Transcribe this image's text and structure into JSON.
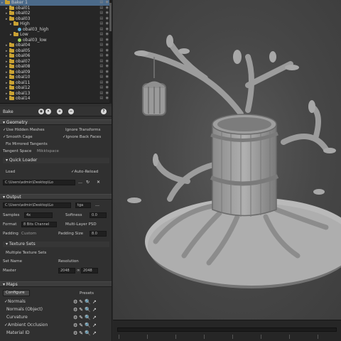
{
  "tree": {
    "rows": [
      {
        "label": "Baker 1",
        "depth": 0,
        "type": "folder",
        "selected": true
      },
      {
        "label": "obal01",
        "depth": 1,
        "type": "folder"
      },
      {
        "label": "obal02",
        "depth": 1,
        "type": "folder"
      },
      {
        "label": "obal03",
        "depth": 1,
        "type": "folder"
      },
      {
        "label": "High",
        "depth": 2,
        "type": "folder"
      },
      {
        "label": "obal03_high",
        "depth": 3,
        "type": "mesh"
      },
      {
        "label": "Low",
        "depth": 2,
        "type": "folder"
      },
      {
        "label": "obal03_low",
        "depth": 3,
        "type": "meshg"
      },
      {
        "label": "obal04",
        "depth": 1,
        "type": "folder"
      },
      {
        "label": "obal05",
        "depth": 1,
        "type": "folder"
      },
      {
        "label": "obal06",
        "depth": 1,
        "type": "folder"
      },
      {
        "label": "obal07",
        "depth": 1,
        "type": "folder"
      },
      {
        "label": "obal08",
        "depth": 1,
        "type": "folder"
      },
      {
        "label": "obal09",
        "depth": 1,
        "type": "folder"
      },
      {
        "label": "obal10",
        "depth": 1,
        "type": "folder"
      },
      {
        "label": "obal11",
        "depth": 1,
        "type": "folder"
      },
      {
        "label": "obal12",
        "depth": 1,
        "type": "folder"
      },
      {
        "label": "obal13",
        "depth": 1,
        "type": "folder"
      },
      {
        "label": "obal14",
        "depth": 1,
        "type": "folder"
      }
    ]
  },
  "bake_bar": {
    "label": "Bake"
  },
  "geometry": {
    "title": "Geometry",
    "use_hidden_meshes": "Use Hidden Meshes",
    "ignore_transforms": "Ignore Transforms",
    "smooth_cage": "Smooth Cage",
    "ignore_back_faces": "Ignore Back Faces",
    "fix_mirrored_tangents": "Fix Mirrored Tangents",
    "tangent_space_label": "Tangent Space",
    "tangent_space_value": "Mikktspace"
  },
  "quick_loader": {
    "title": "Quick Loader",
    "load_label": "Load",
    "auto_reload": "Auto-Reload",
    "path": "C:\\Users\\admin\\Desktop\\Lo"
  },
  "output": {
    "title": "Output",
    "path": "C:\\Users\\admin\\Desktop\\Lo",
    "format_short": "tga",
    "samples_label": "Samples",
    "samples_value": "4x",
    "softness_label": "Softness",
    "softness_value": "0.0",
    "format_label": "Format",
    "format_value": "8 Bits Channel",
    "multi_layer_psd": "Multi-Layer PSD",
    "padding_label": "Padding",
    "padding_value": "Custom",
    "padding_size_label": "Padding Size",
    "padding_size_value": "8.0"
  },
  "texture_sets": {
    "title": "Texture Sets",
    "multiple": "Multiple Texture Sets",
    "set_name_label": "Set Name",
    "resolution_label": "Resolution",
    "master_label": "Master",
    "res_w": "2048",
    "res_h": "2048"
  },
  "maps": {
    "title": "Maps",
    "configure_label": "Configure",
    "presets_label": "Presets",
    "items": [
      {
        "label": "Normals",
        "checked": true
      },
      {
        "label": "Normals (Object)",
        "checked": false
      },
      {
        "label": "Curvature",
        "checked": false
      },
      {
        "label": "Ambient Occlusion",
        "checked": true
      },
      {
        "label": "Material ID",
        "checked": false
      }
    ]
  },
  "colors": {
    "panel_bg": "#303030",
    "tree_bg": "#262626",
    "selection": "#4b6a8a",
    "folder": "#c9a233",
    "viewport_bg": "#474747",
    "model": "#9a9a9a"
  }
}
